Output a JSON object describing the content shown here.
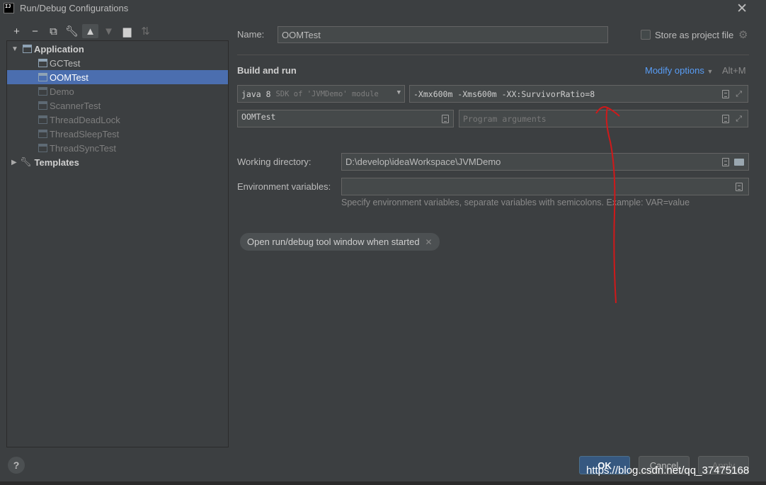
{
  "window": {
    "title": "Run/Debug Configurations",
    "app_icon_text": "IJ"
  },
  "toolbar": {
    "buttons": [
      "add-icon",
      "remove-icon",
      "copy-icon",
      "wrench-icon",
      "move-up-icon",
      "move-down-icon",
      "new-folder-icon",
      "sort-icon"
    ]
  },
  "tree": {
    "application": "Application",
    "items": [
      "GCTest",
      "OOMTest",
      "Demo",
      "ScannerTest",
      "ThreadDeadLock",
      "ThreadSleepTest",
      "ThreadSyncTest"
    ],
    "selected": "OOMTest",
    "templates": "Templates"
  },
  "form": {
    "name_label": "Name:",
    "name_value": "OOMTest",
    "store_label": "Store as project file",
    "build_and_run": "Build and run",
    "modify_options": "Modify options",
    "modify_shortcut": "Alt+M",
    "jre_java": "java 8",
    "jre_sdk": "SDK of 'JVMDemo' module",
    "vm_options": "-Xmx600m -Xms600m -XX:SurvivorRatio=8",
    "main_class": "OOMTest",
    "program_args_placeholder": "Program arguments",
    "working_dir_label": "Working directory:",
    "working_dir_value": "D:\\develop\\ideaWorkspace\\JVMDemo",
    "env_label": "Environment variables:",
    "env_value": "",
    "env_hint": "Specify environment variables, separate variables with semicolons. Example: VAR=value",
    "chip_label": "Open run/debug tool window when started"
  },
  "buttons": {
    "ok": "OK",
    "cancel": "Cancel",
    "apply": "Apply",
    "help": "?"
  },
  "watermark": "https://blog.csdn.net/qq_37475168",
  "colors": {
    "accent": "#4b6eaf",
    "link": "#589df6",
    "annotation": "#d0191a"
  }
}
